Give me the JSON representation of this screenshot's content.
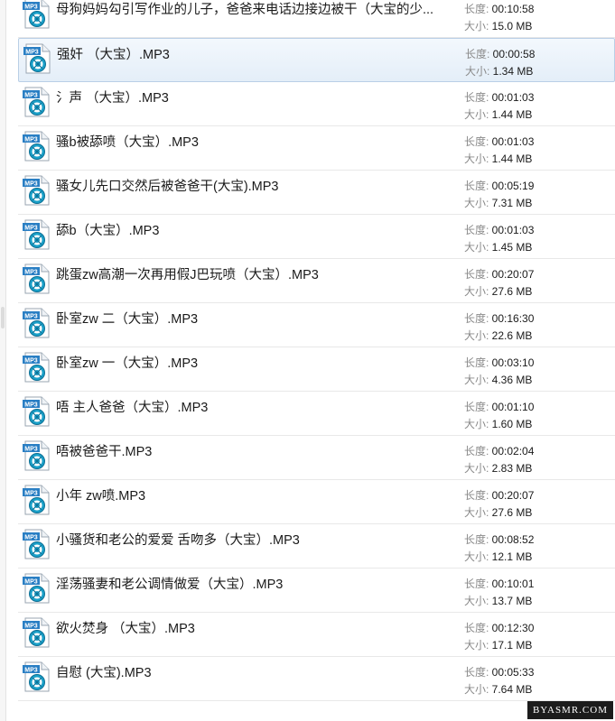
{
  "labels": {
    "length": "长度: ",
    "size": "大小: "
  },
  "icon": {
    "name": "mp3-file-icon",
    "badge": "MP3",
    "accent": "#1a8fd6"
  },
  "files": [
    {
      "name": "母狗妈妈勾引写作业的儿子，爸爸来电话边接边被干（大宝的少...",
      "length": "00:10:58",
      "size": "15.0 MB"
    },
    {
      "name": "强奸 （大宝）.MP3",
      "length": "00:00:58",
      "size": "1.34 MB"
    },
    {
      "name": "氵声 （大宝）.MP3",
      "length": "00:01:03",
      "size": "1.44 MB"
    },
    {
      "name": "骚b被舔喷（大宝）.MP3",
      "length": "00:01:03",
      "size": "1.44 MB"
    },
    {
      "name": "骚女儿先口交然后被爸爸干(大宝).MP3",
      "length": "00:05:19",
      "size": "7.31 MB"
    },
    {
      "name": "舔b（大宝）.MP3",
      "length": "00:01:03",
      "size": "1.45 MB"
    },
    {
      "name": "跳蛋zw高潮一次再用假J巴玩喷（大宝）.MP3",
      "length": "00:20:07",
      "size": "27.6 MB"
    },
    {
      "name": "卧室zw 二（大宝）.MP3",
      "length": "00:16:30",
      "size": "22.6 MB"
    },
    {
      "name": "卧室zw 一（大宝）.MP3",
      "length": "00:03:10",
      "size": "4.36 MB"
    },
    {
      "name": "唔 主人爸爸（大宝）.MP3",
      "length": "00:01:10",
      "size": "1.60 MB"
    },
    {
      "name": "唔被爸爸干.MP3",
      "length": "00:02:04",
      "size": "2.83 MB"
    },
    {
      "name": "小年 zw喷.MP3",
      "length": "00:20:07",
      "size": "27.6 MB"
    },
    {
      "name": "小骚货和老公的爱爱  舌吻多（大宝）.MP3",
      "length": "00:08:52",
      "size": "12.1 MB"
    },
    {
      "name": "淫荡骚妻和老公调情做爱（大宝）.MP3",
      "length": "00:10:01",
      "size": "13.7 MB"
    },
    {
      "name": "欲火焚身 （大宝）.MP3",
      "length": "00:12:30",
      "size": "17.1 MB"
    },
    {
      "name": "自慰 (大宝).MP3",
      "length": "00:05:33",
      "size": "7.64 MB"
    }
  ],
  "selected_index": 1,
  "watermark": "BYASMR.COM"
}
